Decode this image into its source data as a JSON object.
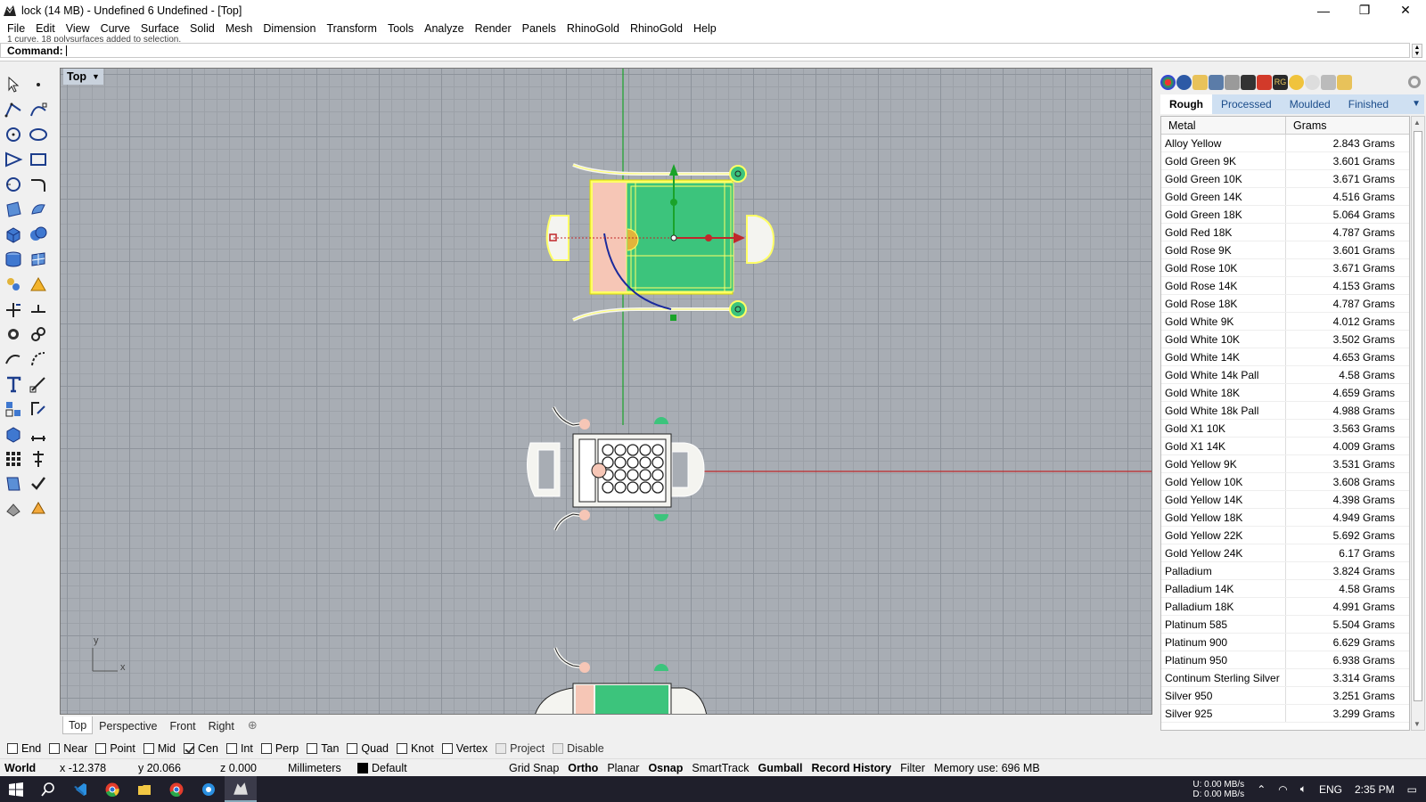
{
  "window": {
    "title": "lock (14 MB) - Undefined 6 Undefined - [Top]",
    "controls": [
      "—",
      "❐",
      "✕"
    ]
  },
  "menu": [
    "File",
    "Edit",
    "View",
    "Curve",
    "Surface",
    "Solid",
    "Mesh",
    "Dimension",
    "Transform",
    "Tools",
    "Analyze",
    "Render",
    "Panels",
    "RhinoGold",
    "RhinoGold",
    "Help"
  ],
  "command": {
    "history": "1 curve, 18 polysurfaces added to selection.",
    "label": "Command:"
  },
  "viewport": {
    "label": "Top",
    "axis_x": "x",
    "axis_y": "y"
  },
  "viewport_tabs": [
    "Top",
    "Perspective",
    "Front",
    "Right"
  ],
  "panel": {
    "tabs": [
      "Rough",
      "Processed",
      "Moulded",
      "Finished"
    ],
    "active_tab": "Rough",
    "columns": [
      "Metal",
      "Grams"
    ],
    "rows": [
      {
        "metal": "Alloy Yellow",
        "grams": "2.843 Grams"
      },
      {
        "metal": "Gold Green 9K",
        "grams": "3.601 Grams"
      },
      {
        "metal": "Gold Green 10K",
        "grams": "3.671 Grams"
      },
      {
        "metal": "Gold Green 14K",
        "grams": "4.516 Grams"
      },
      {
        "metal": "Gold Green 18K",
        "grams": "5.064 Grams"
      },
      {
        "metal": "Gold Red 18K",
        "grams": "4.787 Grams"
      },
      {
        "metal": "Gold Rose 9K",
        "grams": "3.601 Grams"
      },
      {
        "metal": "Gold Rose 10K",
        "grams": "3.671 Grams"
      },
      {
        "metal": "Gold Rose 14K",
        "grams": "4.153 Grams"
      },
      {
        "metal": "Gold Rose 18K",
        "grams": "4.787 Grams"
      },
      {
        "metal": "Gold White 9K",
        "grams": "4.012 Grams"
      },
      {
        "metal": "Gold White 10K",
        "grams": "3.502 Grams"
      },
      {
        "metal": "Gold White 14K",
        "grams": "4.653 Grams"
      },
      {
        "metal": "Gold White 14k Pall",
        "grams": "4.58 Grams"
      },
      {
        "metal": "Gold White 18K",
        "grams": "4.659 Grams"
      },
      {
        "metal": "Gold White 18k Pall",
        "grams": "4.988 Grams"
      },
      {
        "metal": "Gold X1 10K",
        "grams": "3.563 Grams"
      },
      {
        "metal": "Gold X1 14K",
        "grams": "4.009 Grams"
      },
      {
        "metal": "Gold Yellow 9K",
        "grams": "3.531 Grams"
      },
      {
        "metal": "Gold Yellow 10K",
        "grams": "3.608 Grams"
      },
      {
        "metal": "Gold Yellow 14K",
        "grams": "4.398 Grams"
      },
      {
        "metal": "Gold Yellow 18K",
        "grams": "4.949 Grams"
      },
      {
        "metal": "Gold Yellow 22K",
        "grams": "5.692 Grams"
      },
      {
        "metal": "Gold Yellow 24K",
        "grams": "6.17 Grams"
      },
      {
        "metal": "Palladium",
        "grams": "3.824 Grams"
      },
      {
        "metal": "Palladium 14K",
        "grams": "4.58 Grams"
      },
      {
        "metal": "Palladium 18K",
        "grams": "4.991 Grams"
      },
      {
        "metal": "Platinum 585",
        "grams": "5.504 Grams"
      },
      {
        "metal": "Platinum 900",
        "grams": "6.629 Grams"
      },
      {
        "metal": "Platinum 950",
        "grams": "6.938 Grams"
      },
      {
        "metal": "Continum Sterling Silver",
        "grams": "3.314 Grams"
      },
      {
        "metal": "Silver 950",
        "grams": "3.251 Grams"
      },
      {
        "metal": "Silver 925",
        "grams": "3.299 Grams"
      }
    ]
  },
  "osnaps": [
    {
      "label": "End",
      "checked": false
    },
    {
      "label": "Near",
      "checked": false
    },
    {
      "label": "Point",
      "checked": false
    },
    {
      "label": "Mid",
      "checked": false
    },
    {
      "label": "Cen",
      "checked": true
    },
    {
      "label": "Int",
      "checked": false
    },
    {
      "label": "Perp",
      "checked": false
    },
    {
      "label": "Tan",
      "checked": false
    },
    {
      "label": "Quad",
      "checked": false
    },
    {
      "label": "Knot",
      "checked": false
    },
    {
      "label": "Vertex",
      "checked": false
    },
    {
      "label": "Project",
      "checked": false,
      "dim": true
    },
    {
      "label": "Disable",
      "checked": false,
      "dim": true
    }
  ],
  "status": {
    "cplane": "World",
    "x": "x -12.378",
    "y": "y 20.066",
    "z": "z 0.000",
    "units": "Millimeters",
    "layer": "Default",
    "grid_snap": "Grid Snap",
    "ortho": "Ortho",
    "planar": "Planar",
    "osnap": "Osnap",
    "smarttrack": "SmartTrack",
    "gumball": "Gumball",
    "record_history": "Record History",
    "filter": "Filter",
    "memory": "Memory use: 696 MB"
  },
  "taskbar": {
    "net_up": "U:     0.00 MB/s",
    "net_down": "D:     0.00 MB/s",
    "lang": "ENG",
    "time": "2:35 PM"
  },
  "colors": {
    "viewport_bg": "#a8adb4",
    "selection": "#ffff66",
    "gem_green": "#3cc47c",
    "x_axis": "#c0282b",
    "y_axis": "#1aa32a"
  }
}
